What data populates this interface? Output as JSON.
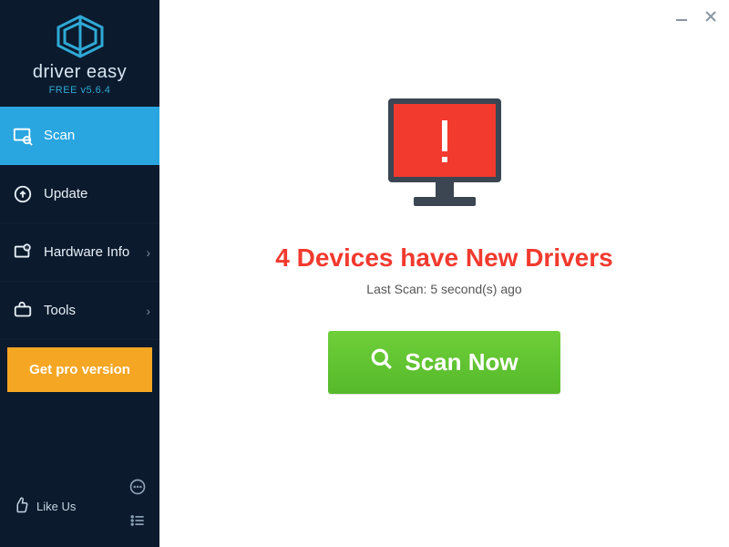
{
  "brand": {
    "name": "driver easy",
    "version": "FREE v5.6.4"
  },
  "sidebar": {
    "items": [
      {
        "label": "Scan"
      },
      {
        "label": "Update"
      },
      {
        "label": "Hardware Info"
      },
      {
        "label": "Tools"
      }
    ],
    "get_pro": "Get pro version",
    "like_us": "Like Us"
  },
  "main": {
    "headline": "4 Devices have New Drivers",
    "subline": "Last Scan: 5 second(s) ago",
    "scan_button": "Scan Now"
  },
  "colors": {
    "accent": "#29a6e0",
    "warning": "#f23a2f",
    "cta": "#f5a623",
    "scan": "#5cc333"
  }
}
